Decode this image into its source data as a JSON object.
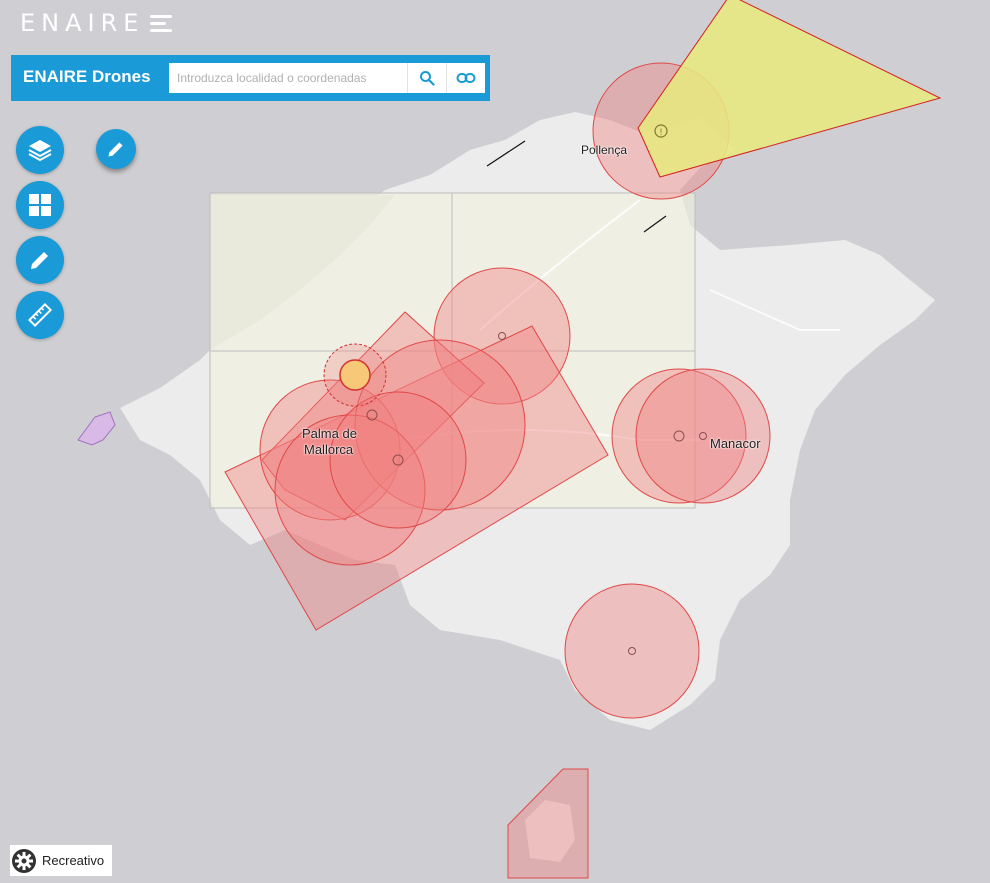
{
  "header": {
    "brand_text": "ENAIRE",
    "app_title": "ENAIRE Drones"
  },
  "search": {
    "placeholder": "Introduzca localidad o coordenadas",
    "value": ""
  },
  "icons": {
    "search": "search-icon",
    "share_link": "link-icon",
    "layers": "layers-icon",
    "basemap": "grid-icon",
    "draw": "pencil-icon",
    "measure": "ruler-icon",
    "settings": "gear-icon"
  },
  "map": {
    "labels": {
      "pollenca": "Pollença",
      "palma_line1": "Palma de",
      "palma_line2": "Mallorca",
      "manacor": "Manacor"
    }
  },
  "footer": {
    "mode_label": "Recreativo"
  },
  "colors": {
    "accent": "#1a9ad6",
    "restricted_zone": "#f08080",
    "warning_zone": "#e8e880",
    "land": "#ececec",
    "sea": "#cfcfd3"
  }
}
